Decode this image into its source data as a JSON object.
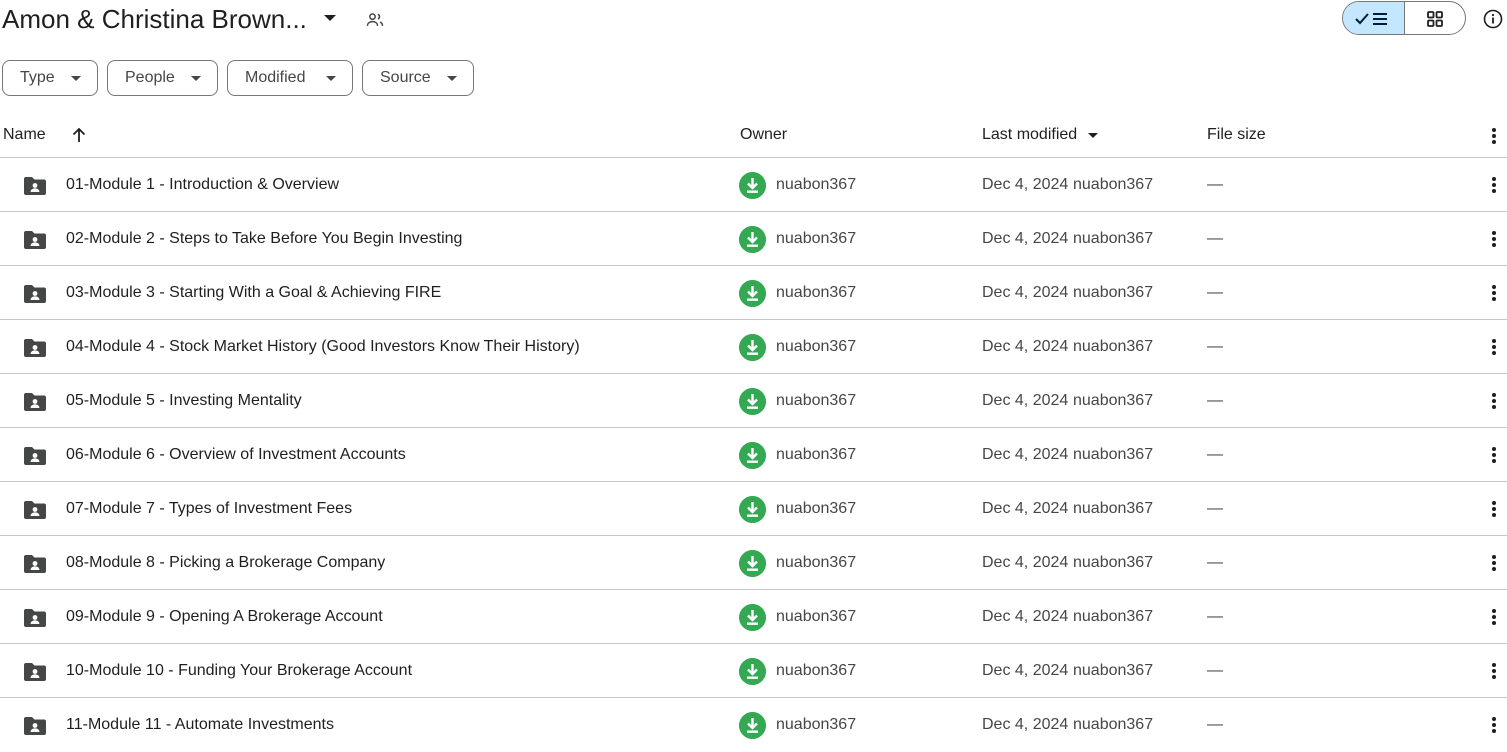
{
  "header": {
    "title": "Amon & Christina Brown...",
    "share_icon": "people-icon",
    "view_list_icon": "check-list-icon",
    "view_grid_icon": "grid-icon",
    "info_icon": "info-icon"
  },
  "filters": [
    {
      "label": "Type"
    },
    {
      "label": "People"
    },
    {
      "label": "Modified"
    },
    {
      "label": "Source"
    }
  ],
  "columns": {
    "name": "Name",
    "owner": "Owner",
    "last_modified": "Last modified",
    "file_size": "File size"
  },
  "rows": [
    {
      "name": "01-Module 1 - Introduction & Overview",
      "owner": "nuabon367",
      "modified": "Dec 4, 2024",
      "modified_by": "nuabon367",
      "size": "—"
    },
    {
      "name": "02-Module 2 - Steps to Take Before You Begin Investing",
      "owner": "nuabon367",
      "modified": "Dec 4, 2024",
      "modified_by": "nuabon367",
      "size": "—"
    },
    {
      "name": "03-Module 3 - Starting With a Goal & Achieving FIRE",
      "owner": "nuabon367",
      "modified": "Dec 4, 2024",
      "modified_by": "nuabon367",
      "size": "—"
    },
    {
      "name": "04-Module 4 - Stock Market History (Good Investors Know Their History)",
      "owner": "nuabon367",
      "modified": "Dec 4, 2024",
      "modified_by": "nuabon367",
      "size": "—"
    },
    {
      "name": "05-Module 5 - Investing Mentality",
      "owner": "nuabon367",
      "modified": "Dec 4, 2024",
      "modified_by": "nuabon367",
      "size": "—"
    },
    {
      "name": "06-Module 6 - Overview of Investment Accounts",
      "owner": "nuabon367",
      "modified": "Dec 4, 2024",
      "modified_by": "nuabon367",
      "size": "—"
    },
    {
      "name": "07-Module 7 - Types of Investment Fees",
      "owner": "nuabon367",
      "modified": "Dec 4, 2024",
      "modified_by": "nuabon367",
      "size": "—"
    },
    {
      "name": "08-Module 8 - Picking a Brokerage Company",
      "owner": "nuabon367",
      "modified": "Dec 4, 2024",
      "modified_by": "nuabon367",
      "size": "—"
    },
    {
      "name": "09-Module 9 - Opening A Brokerage Account",
      "owner": "nuabon367",
      "modified": "Dec 4, 2024",
      "modified_by": "nuabon367",
      "size": "—"
    },
    {
      "name": "10-Module 10 - Funding Your Brokerage Account",
      "owner": "nuabon367",
      "modified": "Dec 4, 2024",
      "modified_by": "nuabon367",
      "size": "—"
    },
    {
      "name": "11-Module 11 - Automate Investments",
      "owner": "nuabon367",
      "modified": "Dec 4, 2024",
      "modified_by": "nuabon367",
      "size": "—"
    }
  ]
}
